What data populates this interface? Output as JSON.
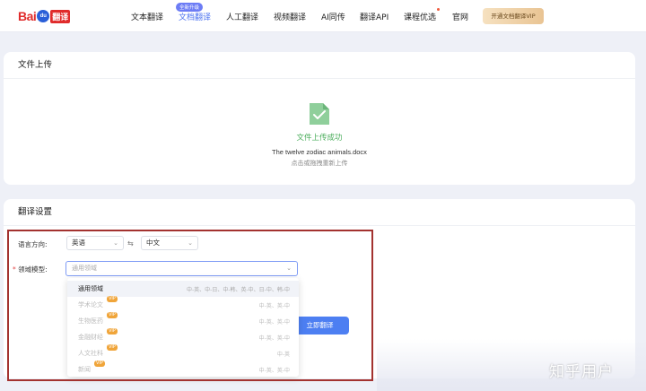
{
  "header": {
    "logo": {
      "bai": "Bai",
      "du": "du",
      "fanyi": "翻译"
    },
    "nav": [
      {
        "label": "文本翻译",
        "active": false
      },
      {
        "label": "文档翻译",
        "active": true
      },
      {
        "label": "人工翻译",
        "active": false
      },
      {
        "label": "视频翻译",
        "active": false
      },
      {
        "label": "AI同传",
        "active": false
      },
      {
        "label": "翻译API",
        "active": false
      },
      {
        "label": "课程优选",
        "active": false
      },
      {
        "label": "官网",
        "active": false
      }
    ],
    "new_badge": "全新升级",
    "vip_button": "开通文档翻译VIP"
  },
  "upload": {
    "title": "文件上传",
    "status": "文件上传成功",
    "file_name": "The twelve zodiac animals.docx",
    "reupload_hint": "点击或拖拽重新上传"
  },
  "settings": {
    "title": "翻译设置",
    "language_label": "语言方向:",
    "source_lang": "英语",
    "target_lang": "中文",
    "domain_label": "领域模型:",
    "domain_placeholder": "通用领域",
    "translate_button": "立即翻译",
    "domains": [
      {
        "name": "通用领域",
        "vip": false,
        "langs": "中-英、中-日、中-韩、英-中、日-中、韩-中",
        "selected": true
      },
      {
        "name": "学术论文",
        "vip": true,
        "langs": "中-英、英-中",
        "selected": false
      },
      {
        "name": "生物医药",
        "vip": true,
        "langs": "中-英、英-中",
        "selected": false
      },
      {
        "name": "金融财经",
        "vip": true,
        "langs": "中-英、英-中",
        "selected": false
      },
      {
        "name": "人文社科",
        "vip": true,
        "langs": "中-英",
        "selected": false
      },
      {
        "name": "新闻",
        "vip": true,
        "langs": "中-英、英-中",
        "selected": false
      }
    ],
    "vip_tag": "VIP"
  },
  "watermark": "知乎用户",
  "colors": {
    "accent": "#4b72f0",
    "success": "#4aad5b",
    "highlight_box": "#a3322f",
    "vip": "#f0a53a"
  }
}
